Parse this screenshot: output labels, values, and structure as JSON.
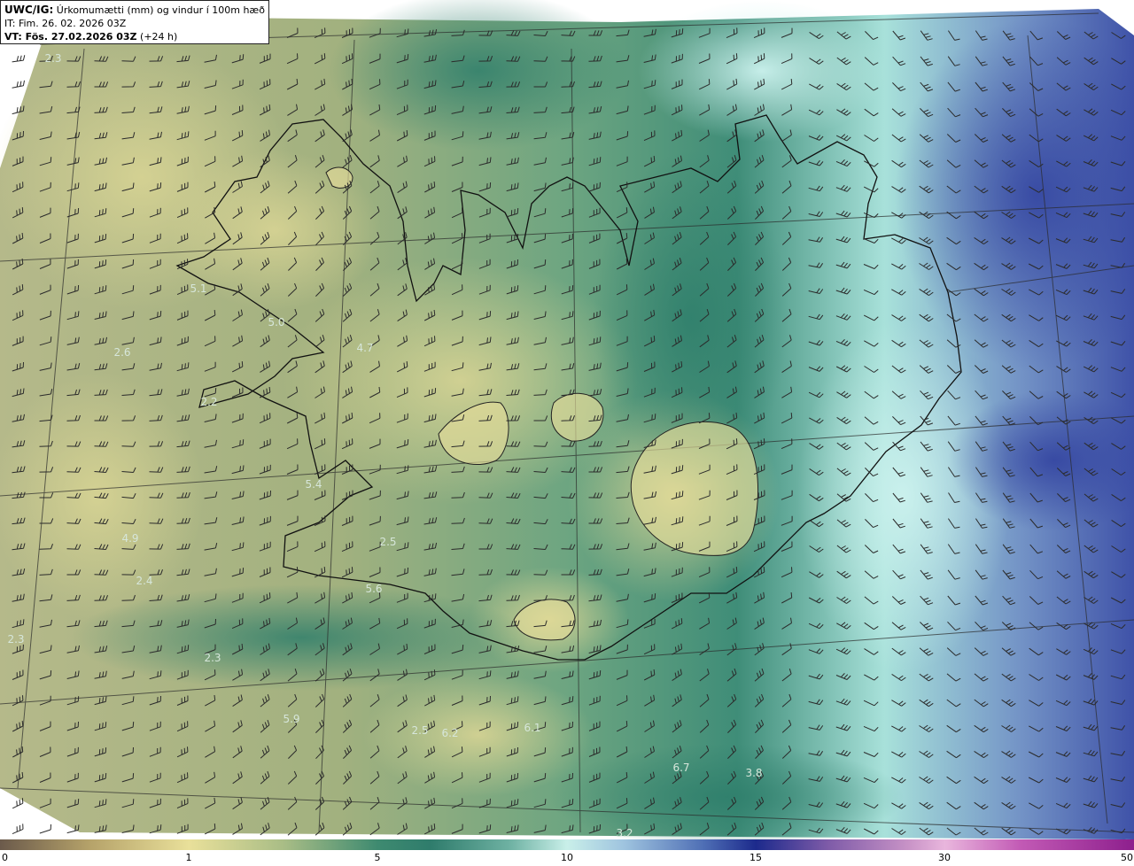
{
  "header": {
    "model": "UWC/IG:",
    "description": "Úrkomumætti (mm) og vindur í 100m hæð",
    "init_time": "IT: Fim. 26. 02. 2026 03Z",
    "valid_label": "VT: Fös. 27.02.2026 03Z",
    "lead": "(+24 h)"
  },
  "colorbar": {
    "ticks": [
      "0",
      "1",
      "5",
      "10",
      "15",
      "30",
      "50"
    ]
  },
  "value_labels": [
    {
      "text": "2.3"
    },
    {
      "text": "5.1"
    },
    {
      "text": "5.0"
    },
    {
      "text": "4.7"
    },
    {
      "text": "2.6"
    },
    {
      "text": "2.2"
    },
    {
      "text": "5.4"
    },
    {
      "text": "4.9"
    },
    {
      "text": "2.4"
    },
    {
      "text": "2.5"
    },
    {
      "text": "5.6"
    },
    {
      "text": "2.3"
    },
    {
      "text": "2.3"
    },
    {
      "text": "5.9"
    },
    {
      "text": "2.5"
    },
    {
      "text": "6.2"
    },
    {
      "text": "6.1"
    },
    {
      "text": "6.7"
    },
    {
      "text": "3.8"
    },
    {
      "text": "3.2"
    }
  ]
}
